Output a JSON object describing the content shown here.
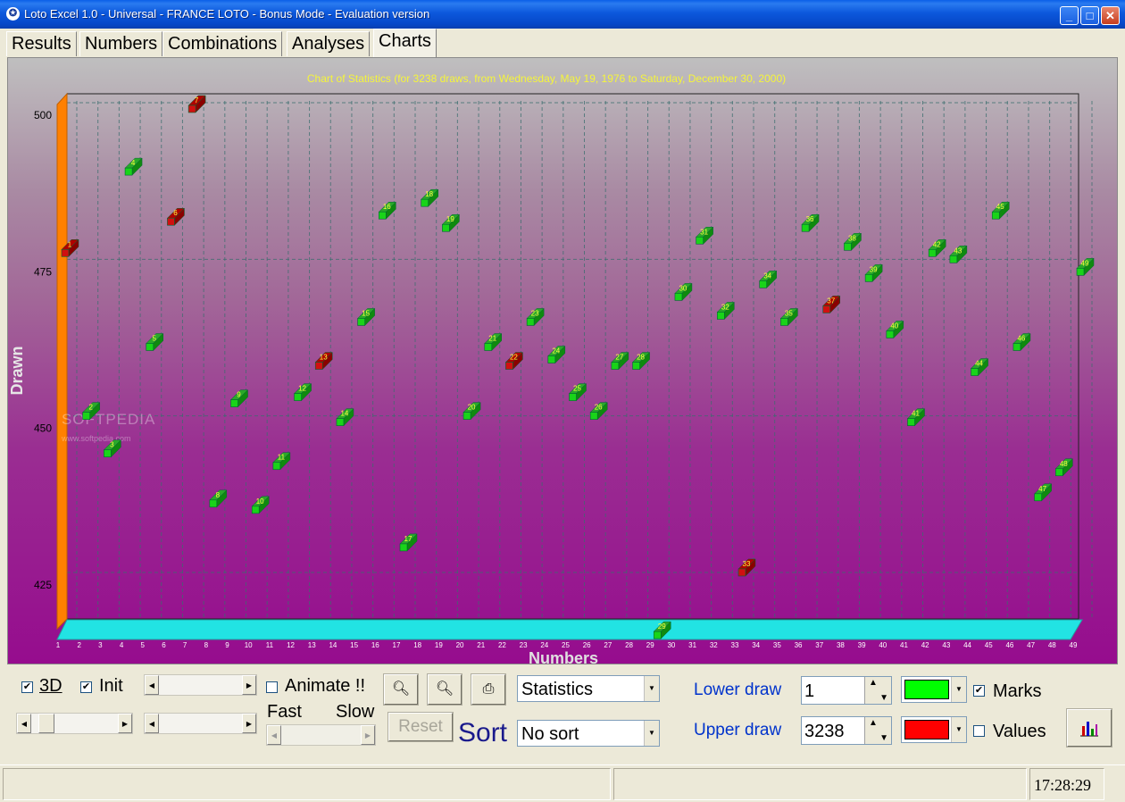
{
  "window": {
    "title": "Loto Excel 1.0 - Universal - FRANCE LOTO - Bonus Mode - Evaluation version"
  },
  "tabs": [
    {
      "label": "Results"
    },
    {
      "label": "Numbers"
    },
    {
      "label": "Combinations"
    },
    {
      "label": "Analyses"
    },
    {
      "label": "Charts"
    }
  ],
  "active_tab": "Charts",
  "chart_data": {
    "type": "scatter",
    "title": "Chart of Statistics (for 3238 draws, from Wednesday, May 19, 1976 to Saturday, December 30, 2000)",
    "xlabel": "Numbers",
    "ylabel": "Drawn",
    "ylim": [
      417,
      502
    ],
    "yticks": [
      425,
      450,
      475,
      500
    ],
    "three_d": true,
    "grid": true,
    "colors": {
      "normal": "#19c419",
      "lower": "#19ef19",
      "upper": "#d01010",
      "floor": "#22e3e3",
      "wall": "#ff8000"
    },
    "highlight": [
      1,
      7,
      6,
      13,
      22,
      33,
      37
    ],
    "points": [
      {
        "x": 1,
        "y": 478
      },
      {
        "x": 2,
        "y": 452
      },
      {
        "x": 3,
        "y": 446
      },
      {
        "x": 4,
        "y": 491
      },
      {
        "x": 5,
        "y": 463
      },
      {
        "x": 6,
        "y": 483
      },
      {
        "x": 7,
        "y": 501
      },
      {
        "x": 8,
        "y": 438
      },
      {
        "x": 9,
        "y": 454
      },
      {
        "x": 10,
        "y": 437
      },
      {
        "x": 11,
        "y": 444
      },
      {
        "x": 12,
        "y": 455
      },
      {
        "x": 13,
        "y": 460
      },
      {
        "x": 14,
        "y": 451
      },
      {
        "x": 15,
        "y": 467
      },
      {
        "x": 16,
        "y": 484
      },
      {
        "x": 17,
        "y": 431
      },
      {
        "x": 18,
        "y": 486
      },
      {
        "x": 19,
        "y": 482
      },
      {
        "x": 20,
        "y": 452
      },
      {
        "x": 21,
        "y": 463
      },
      {
        "x": 22,
        "y": 460
      },
      {
        "x": 23,
        "y": 467
      },
      {
        "x": 24,
        "y": 461
      },
      {
        "x": 25,
        "y": 455
      },
      {
        "x": 26,
        "y": 452
      },
      {
        "x": 27,
        "y": 460
      },
      {
        "x": 28,
        "y": 460
      },
      {
        "x": 29,
        "y": 417
      },
      {
        "x": 30,
        "y": 471
      },
      {
        "x": 31,
        "y": 480
      },
      {
        "x": 32,
        "y": 468
      },
      {
        "x": 33,
        "y": 427
      },
      {
        "x": 34,
        "y": 473
      },
      {
        "x": 35,
        "y": 467
      },
      {
        "x": 36,
        "y": 482
      },
      {
        "x": 37,
        "y": 469
      },
      {
        "x": 38,
        "y": 479
      },
      {
        "x": 39,
        "y": 474
      },
      {
        "x": 40,
        "y": 465
      },
      {
        "x": 41,
        "y": 451
      },
      {
        "x": 42,
        "y": 478
      },
      {
        "x": 43,
        "y": 477
      },
      {
        "x": 44,
        "y": 459
      },
      {
        "x": 45,
        "y": 484
      },
      {
        "x": 46,
        "y": 463
      },
      {
        "x": 47,
        "y": 439
      },
      {
        "x": 48,
        "y": 443
      },
      {
        "x": 49,
        "y": 475
      }
    ]
  },
  "watermark": {
    "brand": "SOFTPEDIA",
    "url": "www.softpedia.com"
  },
  "controls": {
    "cb_3d": {
      "label": "3D",
      "checked": true
    },
    "cb_init": {
      "label": "Init",
      "checked": true
    },
    "cb_animate": {
      "label": "Animate !!",
      "checked": false
    },
    "fast_label": "Fast",
    "slow_label": "Slow",
    "reset_label": "Reset",
    "sort_label": "Sort",
    "stat_mode": "Statistics",
    "sort_mode": "No sort",
    "lower_draw_label": "Lower draw",
    "lower_draw_value": "1",
    "upper_draw_label": "Upper draw",
    "upper_draw_value": "3238",
    "lower_color": "#00ff00",
    "upper_color": "#ff0000",
    "cb_marks": {
      "label": "Marks",
      "checked": true
    },
    "cb_values": {
      "label": "Values",
      "checked": false
    },
    "icons": {
      "zoom_in": "zoom-in-icon",
      "zoom_out": "zoom-out-icon",
      "print": "printer-icon",
      "chart": "bar-chart-icon"
    }
  },
  "status": {
    "time": "17:28:29"
  }
}
